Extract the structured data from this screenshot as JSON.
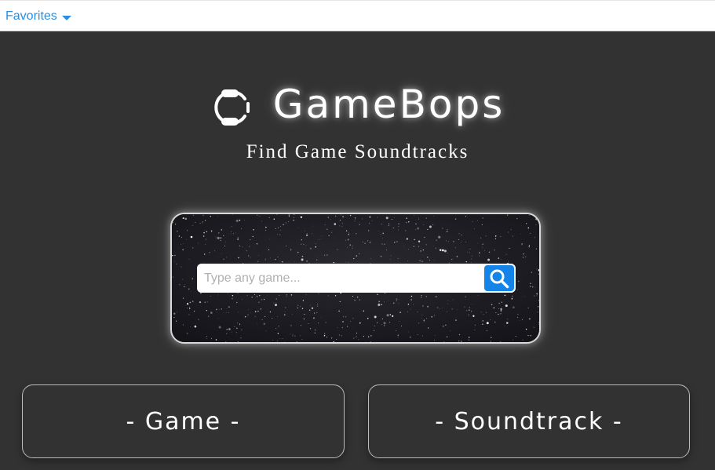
{
  "topbar": {
    "favorites_label": "Favorites",
    "favorites_icon": "caret-down-icon",
    "link_color": "#2a8ee0"
  },
  "brand": {
    "logo_icon": "headset-icon",
    "title": "GameBops",
    "subtitle": "Find Game Soundtracks"
  },
  "search": {
    "placeholder": "Type any game...",
    "value": "",
    "button_icon": "search-icon",
    "button_color": "#1484e8",
    "background": "starfield"
  },
  "buttons": {
    "game_label": "- Game -",
    "soundtrack_label": "- Soundtrack -"
  },
  "colors": {
    "page_background": "#323232"
  }
}
